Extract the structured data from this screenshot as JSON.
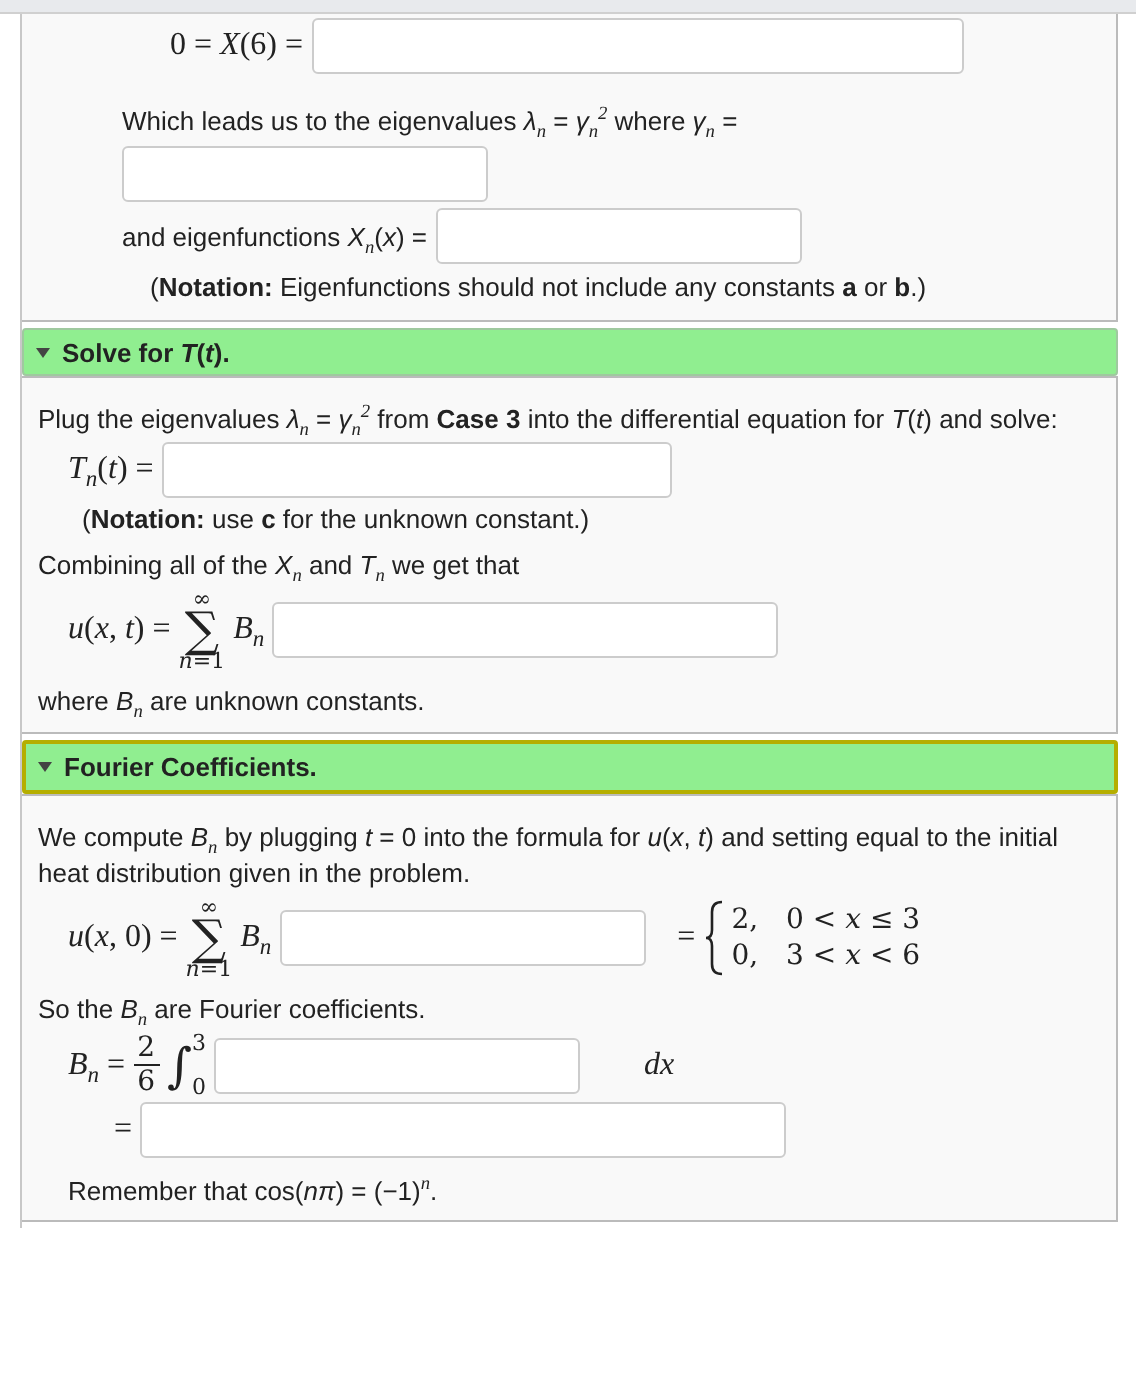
{
  "sections": [
    {
      "items": [
        {
          "kind": "equation",
          "lhs": "0 = *X*(6) ="
        },
        {
          "kind": "text",
          "text": "Which leads us to the eigenvalues *λ*$_{n}$ = *γ*$_{n}$$^{2}$ where *γ*$_{n}$ ="
        },
        {
          "kind": "field"
        },
        {
          "kind": "inline",
          "lhs": "and eigenfunctions *X*$_{n}$(*x*) ="
        },
        {
          "kind": "note",
          "text": "(**Notation:** Eigenfunctions should not include any constants **a** or **b**.)"
        }
      ]
    },
    {
      "header": {
        "title": "Solve for *T*(*t*).",
        "expanded": true,
        "focused": false
      },
      "items": [
        {
          "kind": "text",
          "text": "Plug the eigenvalues *λ*$_{n}$ = *γ*$_{n}$$^{2}$ from **Case 3** into the differential equation for *T*(*t*) and solve:"
        },
        {
          "kind": "equation",
          "lhs": "*T*$_{n}$(*t*) ="
        },
        {
          "kind": "note",
          "text": "(**Notation:** use **c** for the unknown constant.)"
        },
        {
          "kind": "text",
          "text": "Combining all of the *X*$_{n}$ and *T*$_{n}$ we get that"
        },
        {
          "kind": "sum",
          "lhs": "*u*(*x*, *t*) =",
          "symbol": "∑",
          "upper": "∞",
          "lower": "*n*=1",
          "term": "*B*$_{n}$"
        },
        {
          "kind": "text",
          "text": "where *B*$_{n}$ are unknown constants."
        }
      ]
    },
    {
      "header": {
        "title": "Fourier Coefficients.",
        "expanded": true,
        "focused": true
      },
      "items": [
        {
          "kind": "text",
          "text": "We compute *B*$_{n}$ by plugging *t* = 0 into the formula for *u*(*x*, *t*) and setting equal to the initial heat distribution given in the problem."
        },
        {
          "kind": "sum",
          "lhs": "*u*(*x*, 0) =",
          "symbol": "∑",
          "upper": "∞",
          "lower": "*n*=1",
          "term": "*B*$_{n}$",
          "rhs": {
            "eq": "=",
            "cases": [
              {
                "value": "2,",
                "condition": "0 < *x* ≤ 3"
              },
              {
                "value": "0,",
                "condition": "3 < *x* < 6"
              }
            ]
          }
        },
        {
          "kind": "text",
          "text": "So the *B*$_{n}$ are Fourier coefficients."
        },
        {
          "kind": "integral",
          "lhs": "*B*$_{n}$ =",
          "numerator": "2",
          "denominator": "6",
          "symbol": "∫",
          "upper": "3",
          "lower": "0",
          "suffix": "*dx*"
        },
        {
          "kind": "equation",
          "lhs": "="
        },
        {
          "kind": "remark",
          "text": "Remember that cos(*nπ*) = (−1)$^{n}$."
        }
      ]
    }
  ]
}
